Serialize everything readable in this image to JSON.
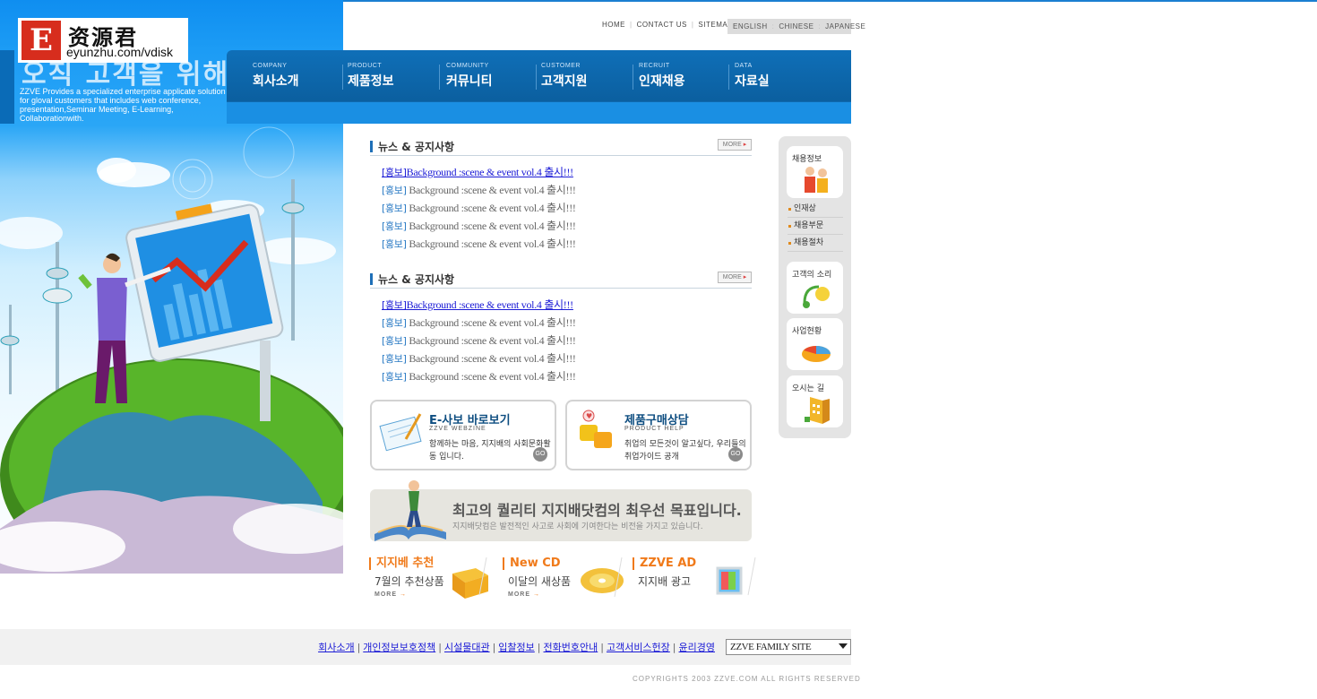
{
  "logo": {
    "letter": "E",
    "brand": "资源君",
    "url": "eyunzhu.com/vdisk"
  },
  "hero": {
    "slogan": "오직 고객을 위해",
    "description": "ZZVE Provides a specialized enterprise applicate solution for gloval customers that includes web conference, presentation,Seminar Meeting, E-Learning, Collaborationwith."
  },
  "utility_nav": {
    "home": "HOME",
    "contact": "CONTACT US",
    "sitemap": "SITEMAP"
  },
  "languages": {
    "english": "ENGLISH",
    "chinese": "CHINESE",
    "japanese": "JAPANESE"
  },
  "gnb": [
    {
      "en": "COMPANY",
      "ko": "회사소개"
    },
    {
      "en": "PRODUCT",
      "ko": "제품정보"
    },
    {
      "en": "COMMUNITY",
      "ko": "커뮤니티"
    },
    {
      "en": "CUSTOMER",
      "ko": "고객지원"
    },
    {
      "en": "RECRUIT",
      "ko": "인재채용"
    },
    {
      "en": "DATA",
      "ko": "자료실"
    }
  ],
  "more_label": "MORE",
  "news_sections": [
    {
      "title": "뉴스 & 공지사항",
      "items": [
        {
          "tag": "[홍보]",
          "text": "Background :scene & event vol.4 출시!!!"
        },
        {
          "tag": "[홍보]",
          "text": "Background :scene & event vol.4 출시!!!"
        },
        {
          "tag": "[홍보]",
          "text": "Background :scene & event vol.4 출시!!!"
        },
        {
          "tag": "[홍보]",
          "text": "Background :scene & event vol.4 출시!!!"
        },
        {
          "tag": "[홍보]",
          "text": "Background :scene & event vol.4 출시!!!"
        }
      ]
    },
    {
      "title": "뉴스 & 공지사항",
      "items": [
        {
          "tag": "[홍보]",
          "text": "Background :scene & event vol.4 출시!!!"
        },
        {
          "tag": "[홍보]",
          "text": "Background :scene & event vol.4 출시!!!"
        },
        {
          "tag": "[홍보]",
          "text": "Background :scene & event vol.4 출시!!!"
        },
        {
          "tag": "[홍보]",
          "text": "Background :scene & event vol.4 출시!!!"
        },
        {
          "tag": "[홍보]",
          "text": "Background :scene & event vol.4 출시!!!"
        }
      ]
    }
  ],
  "banners": {
    "webzine": {
      "title": "E-사보 바로보기",
      "sub": "ZZVE WEBZINE",
      "desc": "함께하는 마음, 지지배의 사회문화활동 입니다.",
      "go": "GO"
    },
    "product_help": {
      "title": "제품구매상담",
      "sub": "PRODUCT HELP",
      "desc": "취업의 모든것이 알고싶다, 우리들의 취업가이드 공개",
      "go": "GO"
    }
  },
  "wide_banner": {
    "title": "최고의 퀄리티 지지배닷컴의 최우선 목표입니다.",
    "sub": "지지배닷컴은 발전적인 사고로 사회에 기여한다는 비전을 가지고 있습니다."
  },
  "mini_banners": [
    {
      "title": "지지베 추천",
      "sub": "7월의 추천상품",
      "more": "MORE"
    },
    {
      "title": "New CD",
      "sub": "이달의 새상품",
      "more": "MORE"
    },
    {
      "title": "ZZVE AD",
      "sub": "지지배 광고",
      "more": ""
    }
  ],
  "quick_menu": {
    "recruit": {
      "label": "채용정보"
    },
    "links": [
      "인재상",
      "채용부문",
      "채용절차"
    ],
    "voice": {
      "label": "고객의 소리"
    },
    "business": {
      "label": "사업현황"
    },
    "directions": {
      "label": "오시는 길"
    }
  },
  "footer": {
    "links": [
      "회사소개",
      "개인정보보호정책",
      "시설물대관",
      "입찰정보",
      "전화번호안내",
      "고객서비스헌장",
      "윤리경영"
    ],
    "family_site": "ZZVE FAMILY SITE",
    "copyright": "COPYRIGHTS 2003 ZZVE.COM ALL RIGHTS RESERVED"
  },
  "colors": {
    "primary_blue": "#0b5f9f",
    "accent_orange": "#f07a1a",
    "link_blue": "#1b1bd6"
  }
}
